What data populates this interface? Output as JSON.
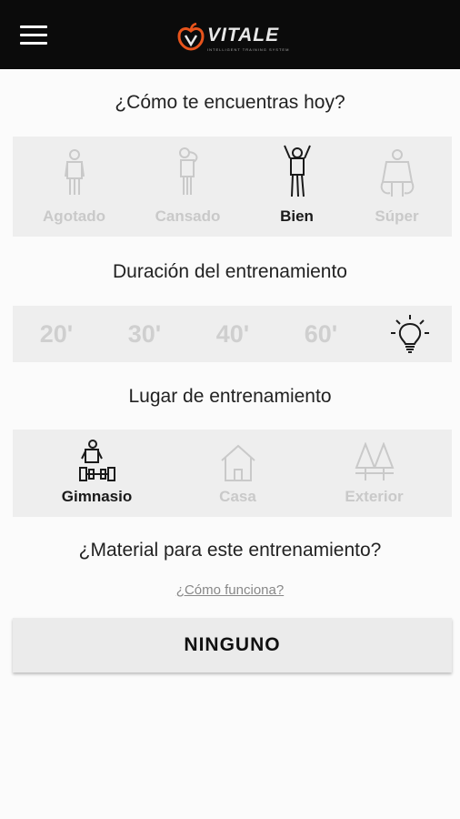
{
  "header": {
    "menu_icon": "hamburger-menu-icon",
    "logo_text": "VITALE",
    "logo_sub": "INTELLIGENT TRAINING SYSTEM",
    "logo_colors": {
      "accent": "#e8541c",
      "text": "#e8e8e8"
    }
  },
  "mood": {
    "title": "¿Cómo te encuentras hoy?",
    "options": [
      {
        "label": "Agotado",
        "icon": "exhausted-person-icon",
        "selected": false
      },
      {
        "label": "Cansado",
        "icon": "tired-person-icon",
        "selected": false
      },
      {
        "label": "Bien",
        "icon": "good-person-icon",
        "selected": true
      },
      {
        "label": "Súper",
        "icon": "super-person-icon",
        "selected": false
      }
    ]
  },
  "duration": {
    "title": "Duración del entrenamiento",
    "options": [
      "20'",
      "30'",
      "40'",
      "60'"
    ],
    "auto_icon": "lightbulb-icon"
  },
  "location": {
    "title": "Lugar de entrenamiento",
    "options": [
      {
        "label": "Gimnasio",
        "icon": "gym-icon",
        "selected": true
      },
      {
        "label": "Casa",
        "icon": "house-icon",
        "selected": false
      },
      {
        "label": "Exterior",
        "icon": "trees-icon",
        "selected": false
      }
    ]
  },
  "material": {
    "title": "¿Material para este entrenamiento?",
    "link": "¿Cómo funciona?",
    "button": "NINGUNO"
  },
  "colors": {
    "selected": "#1a1a1a",
    "unselected": "#c9c9c9",
    "panel": "#eeeeee"
  }
}
